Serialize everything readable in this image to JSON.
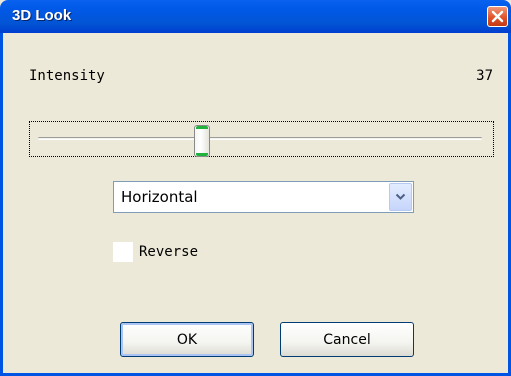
{
  "window": {
    "title": "3D Look",
    "close_icon": "close-icon"
  },
  "intensity": {
    "label": "Intensity",
    "value": "37",
    "slider_fraction": 0.37
  },
  "direction": {
    "selected": "Horizontal",
    "dropdown_icon": "chevron-down-icon"
  },
  "reverse": {
    "label": "Reverse",
    "checked": false
  },
  "buttons": {
    "ok_label": "OK",
    "cancel_label": "Cancel"
  },
  "colors": {
    "titlebar": "#0058e6",
    "close_button": "#e0532b",
    "dialog_background": "#ece9d8",
    "slider_thumb_accent": "#1fb33d"
  }
}
